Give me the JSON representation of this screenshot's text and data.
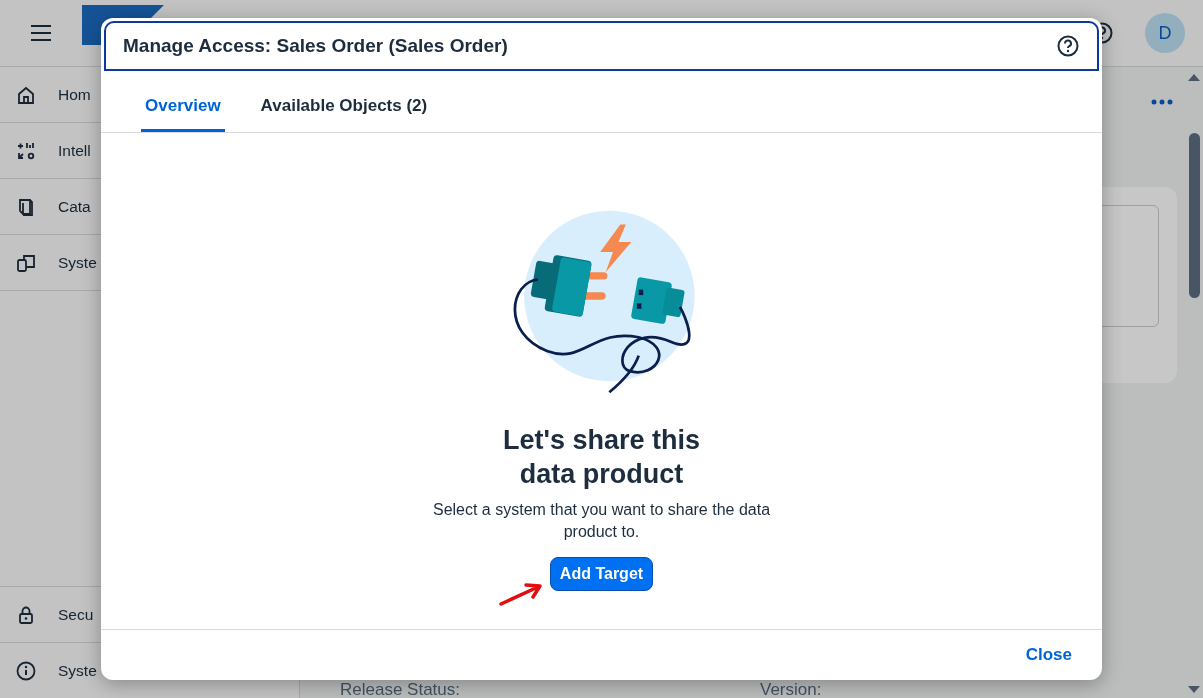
{
  "shell": {
    "avatar": "D"
  },
  "sidebar": {
    "items": [
      {
        "label": "Hom"
      },
      {
        "label": "Intell"
      },
      {
        "label": "Cata"
      },
      {
        "label": "Syste"
      }
    ],
    "bottom_items": [
      {
        "label": "Secu"
      },
      {
        "label": "Syste"
      }
    ]
  },
  "main": {
    "fields": [
      {
        "label": "Release Status:"
      },
      {
        "label": "Version:"
      }
    ]
  },
  "dialog": {
    "title": "Manage Access: Sales Order (Sales Order)",
    "tabs": [
      {
        "label": "Overview",
        "selected": true
      },
      {
        "label": "Available Objects (2)",
        "selected": false
      }
    ],
    "heading": "Let's share this data product",
    "description": "Select a system that you want to share the data product to.",
    "primary_button": "Add Target",
    "footer_button": "Close"
  }
}
